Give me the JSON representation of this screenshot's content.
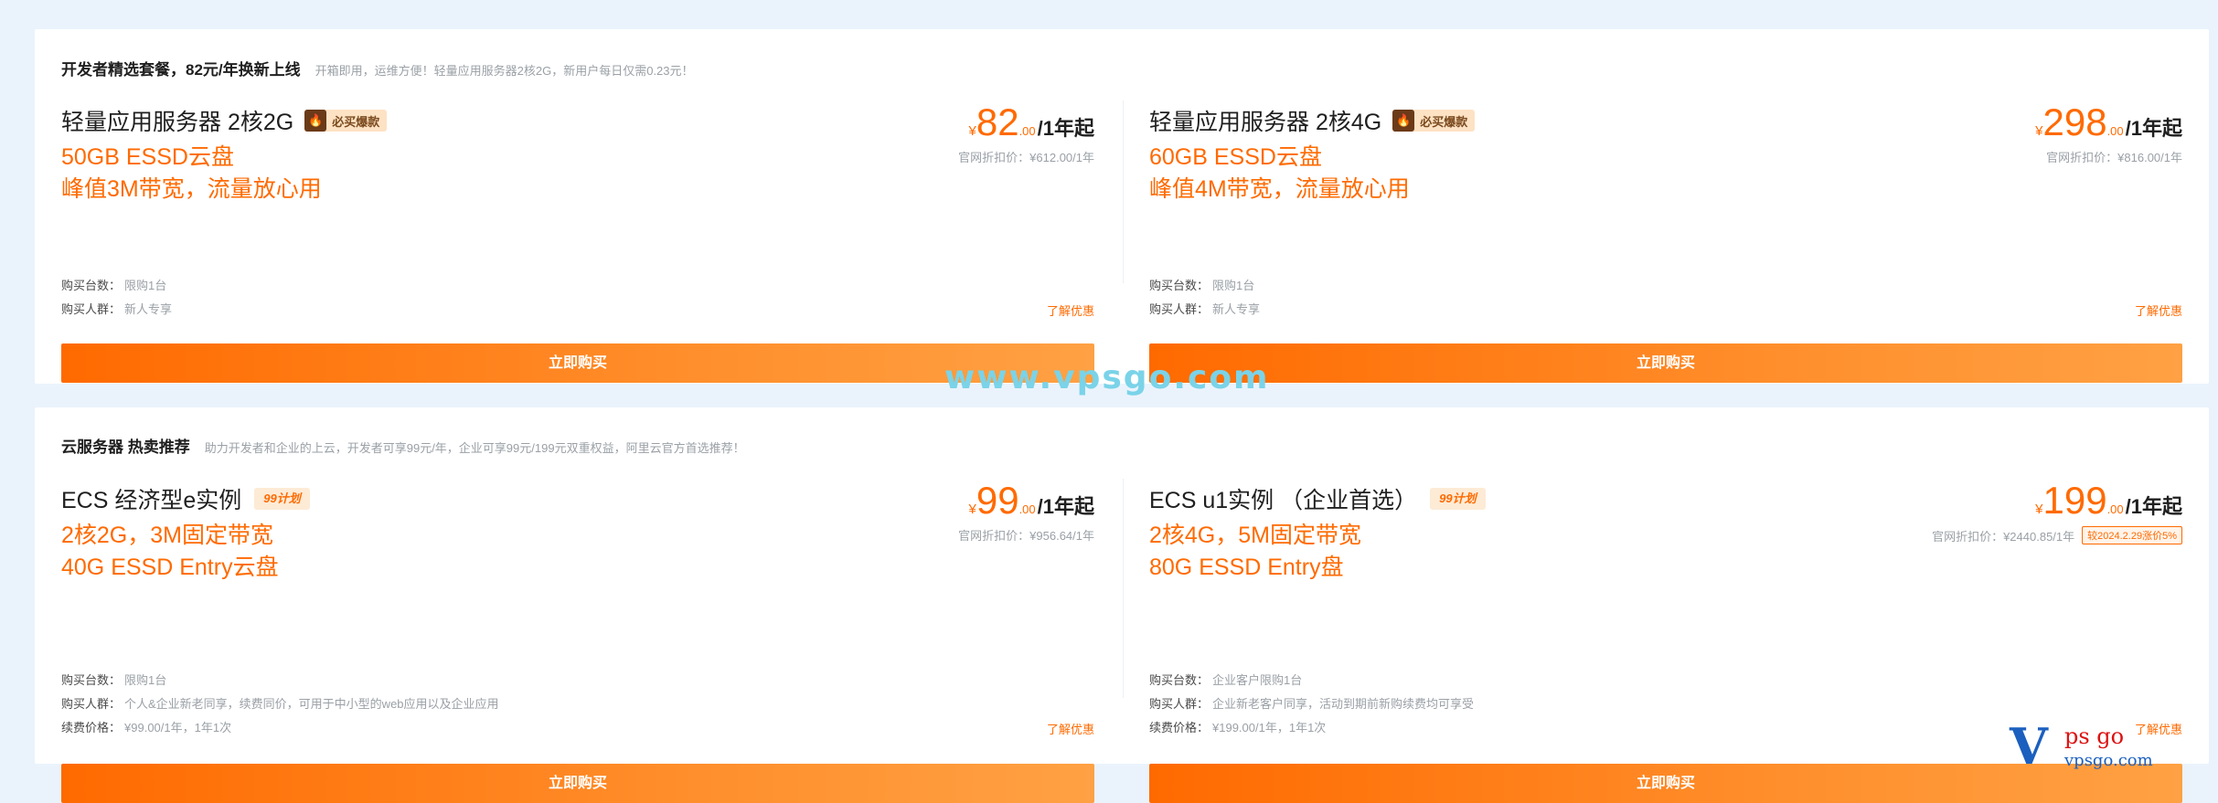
{
  "section1": {
    "title": "开发者精选套餐，82元/年换新上线",
    "desc": "开箱即用，运维方便！轻量应用服务器2核2G，新用户每日仅需0.23元！",
    "cards": [
      {
        "title": "轻量应用服务器 2核2G",
        "badge": "必买爆款",
        "features": [
          "50GB ESSD云盘",
          "峰值3M带宽，流量放心用"
        ],
        "price": {
          "currency": "¥",
          "integer": "82",
          "decimal": ".00",
          "unit": "/1年起"
        },
        "original": "官网折扣价：¥612.00/1年",
        "meta": [
          {
            "k": "购买台数：",
            "v": "限购1台"
          },
          {
            "k": "购买人群：",
            "v": "新人专享"
          }
        ],
        "learn_more": "了解优惠",
        "buy": "立即购买"
      },
      {
        "title": "轻量应用服务器 2核4G",
        "badge": "必买爆款",
        "features": [
          "60GB ESSD云盘",
          "峰值4M带宽，流量放心用"
        ],
        "price": {
          "currency": "¥",
          "integer": "298",
          "decimal": ".00",
          "unit": "/1年起"
        },
        "original": "官网折扣价：¥816.00/1年",
        "meta": [
          {
            "k": "购买台数：",
            "v": "限购1台"
          },
          {
            "k": "购买人群：",
            "v": "新人专享"
          }
        ],
        "learn_more": "了解优惠",
        "buy": "立即购买"
      }
    ]
  },
  "section2": {
    "title": "云服务器 热卖推荐",
    "desc": "助力开发者和企业的上云，开发者可享99元/年，企业可享99元/199元双重权益，阿里云官方首选推荐！",
    "cards": [
      {
        "title": "ECS 经济型e实例",
        "badge": "99计划",
        "features": [
          "2核2G，3M固定带宽",
          "40G ESSD Entry云盘"
        ],
        "price": {
          "currency": "¥",
          "integer": "99",
          "decimal": ".00",
          "unit": "/1年起"
        },
        "original": "官网折扣价：¥956.64/1年",
        "tag": "",
        "meta": [
          {
            "k": "购买台数：",
            "v": "限购1台"
          },
          {
            "k": "购买人群：",
            "v": "个人&企业新老同享，续费同价，可用于中小型的web应用以及企业应用"
          },
          {
            "k": "续费价格：",
            "v": "¥99.00/1年，1年1次"
          }
        ],
        "learn_more": "了解优惠",
        "buy": "立即购买"
      },
      {
        "title": "ECS u1实例 （企业首选）",
        "badge": "99计划",
        "features": [
          "2核4G，5M固定带宽",
          "80G ESSD Entry盘"
        ],
        "price": {
          "currency": "¥",
          "integer": "199",
          "decimal": ".00",
          "unit": "/1年起"
        },
        "original": "官网折扣价：¥2440.85/1年",
        "tag": "较2024.2.29涨价5%",
        "meta": [
          {
            "k": "购买台数：",
            "v": "企业客户限购1台"
          },
          {
            "k": "购买人群：",
            "v": "企业新老客户同享，活动到期前新购续费均可享受"
          },
          {
            "k": "续费价格：",
            "v": "¥199.00/1年，1年1次"
          }
        ],
        "learn_more": "了解优惠",
        "buy": "立即购买"
      }
    ]
  },
  "watermark": "www.vpsgo.com",
  "logo": {
    "letter": "V",
    "text_top": "ps go",
    "text_bottom": "vpsgo.com"
  },
  "colors": {
    "accent": "#ff6a00",
    "background": "#eaf3fc",
    "watermark": "#7ad3e8"
  }
}
